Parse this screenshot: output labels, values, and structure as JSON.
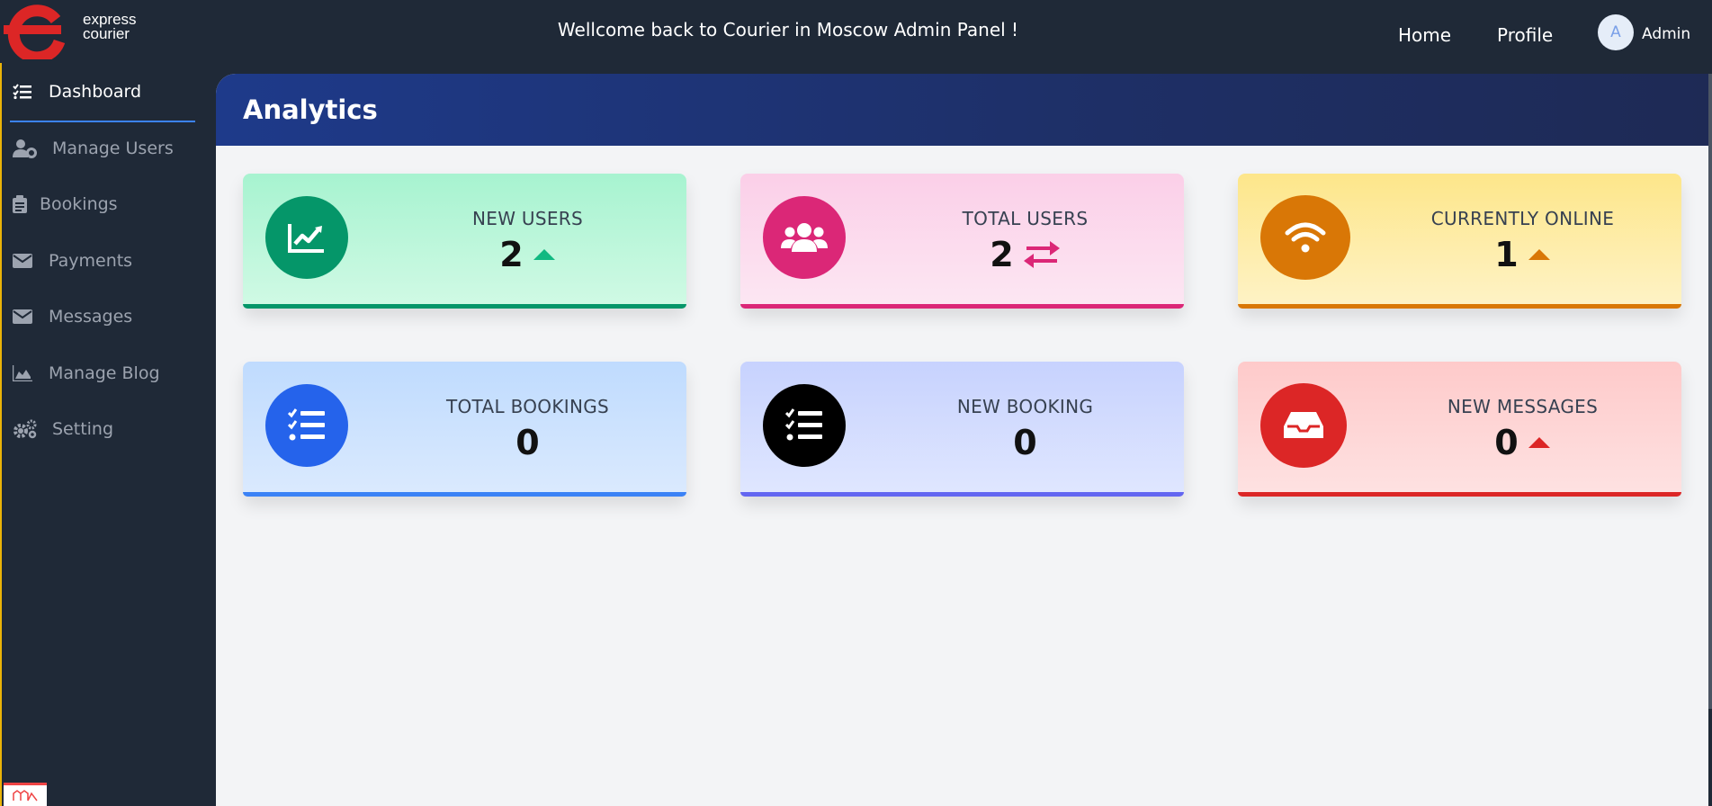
{
  "app": {
    "logo_line1": "express",
    "logo_line2": "courier",
    "welcome": "Wellcome back to Courier in Moscow Admin Panel !",
    "nav_home": "Home",
    "nav_profile": "Profile",
    "avatar_letter": "A",
    "user_name": "Admin"
  },
  "sidebar": {
    "items": [
      {
        "label": "Dashboard",
        "icon": "tasks-icon",
        "active": true
      },
      {
        "label": "Manage Users",
        "icon": "users-cog-icon"
      },
      {
        "label": "Bookings",
        "icon": "clipboard-icon"
      },
      {
        "label": "Payments",
        "icon": "envelope-icon"
      },
      {
        "label": "Messages",
        "icon": "envelope-icon"
      },
      {
        "label": "Manage Blog",
        "icon": "chart-area-icon"
      },
      {
        "label": "Setting",
        "icon": "cogs-icon"
      }
    ]
  },
  "main": {
    "title": "Analytics",
    "cards": [
      {
        "label": "NEW USERS",
        "value": "2",
        "icon": "chart-line-icon",
        "trend": "caret-up-icon",
        "accent": "#059669",
        "bg": "#bbf7d0"
      },
      {
        "label": "TOTAL USERS",
        "value": "2",
        "icon": "users-icon",
        "trend": "exchange-icon",
        "accent": "#db2777",
        "bg": "#fbcfe8"
      },
      {
        "label": "CURRENTLY ONLINE",
        "value": "1",
        "icon": "wifi-icon",
        "trend": "caret-up-icon",
        "accent": "#d97706",
        "bg": "#fde68a"
      },
      {
        "label": "TOTAL BOOKINGS",
        "value": "0",
        "icon": "tasks-icon",
        "accent": "#2563eb",
        "bg": "#bfdbfe"
      },
      {
        "label": "NEW BOOKING",
        "value": "0",
        "icon": "tasks-icon",
        "accent": "#000000",
        "bg": "#c7d2fe"
      },
      {
        "label": "NEW MESSAGES",
        "value": "0",
        "icon": "inbox-icon",
        "trend": "caret-up-icon",
        "accent": "#dc2626",
        "bg": "#fecaca"
      }
    ]
  }
}
